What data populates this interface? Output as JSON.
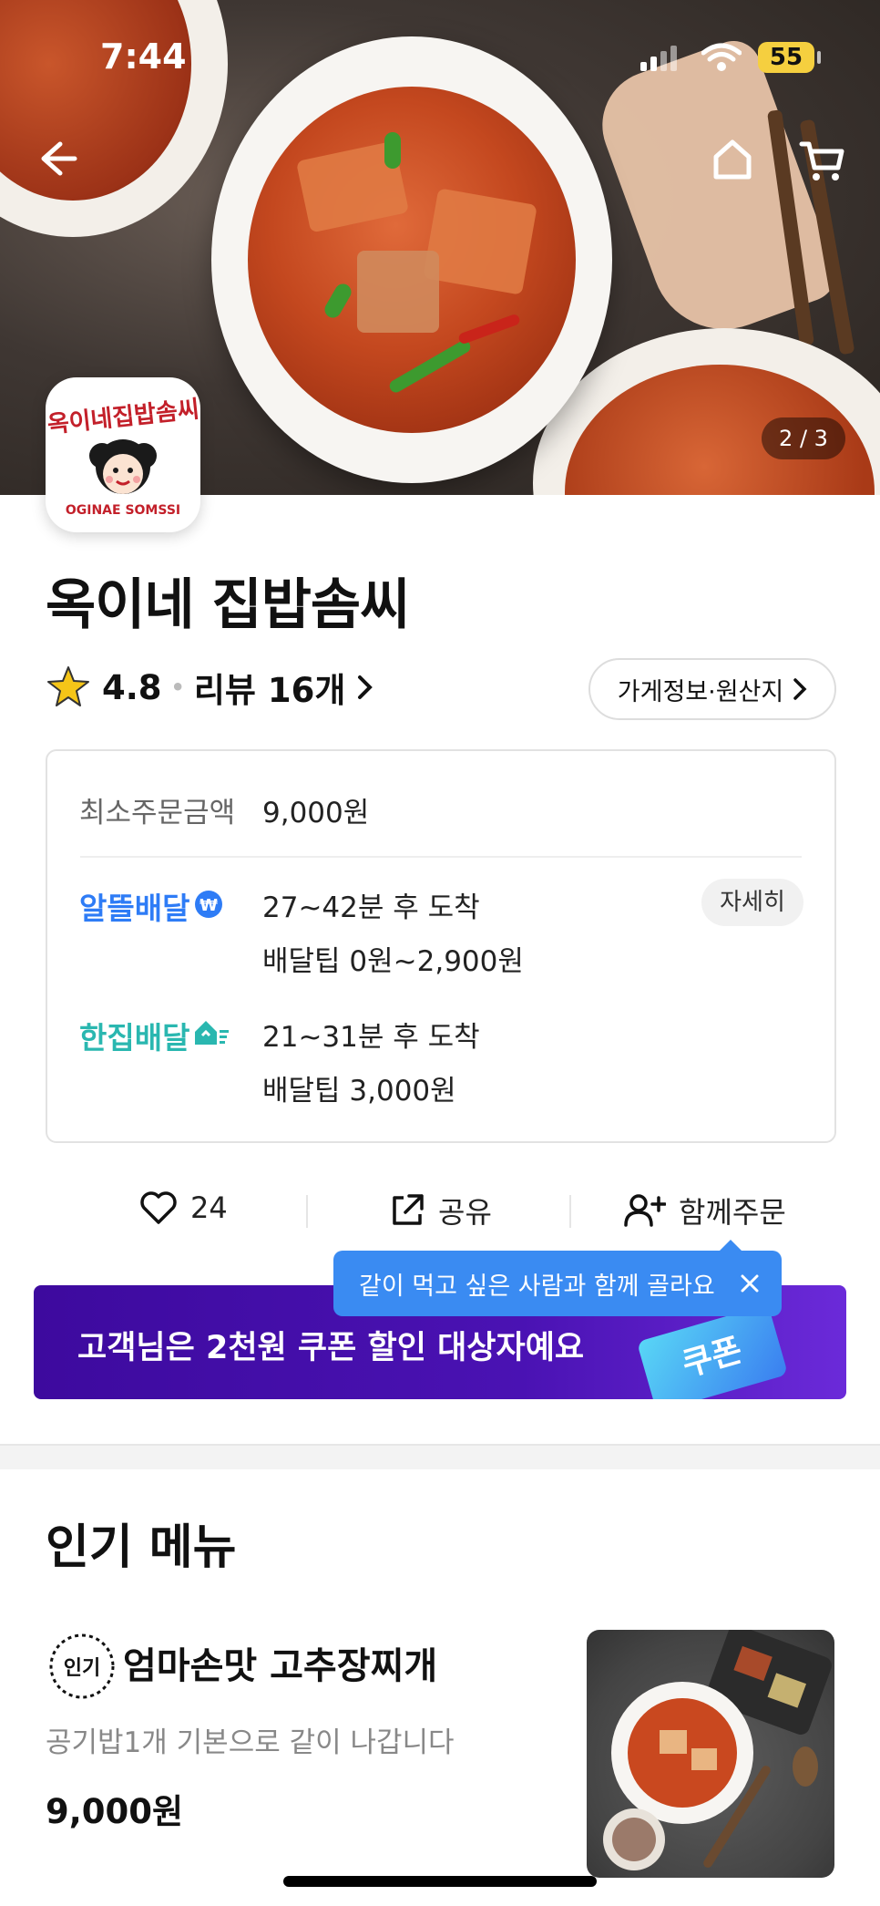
{
  "status_bar": {
    "time": "7:44",
    "battery": "55"
  },
  "hero": {
    "counter": "2 / 3"
  },
  "store": {
    "name": "옥이네 집밥솜씨",
    "logo_text": "옥이네집밥솜씨",
    "logo_subtext": "OGINAE SOMSSI",
    "rating": "4.8",
    "reviews": "리뷰 16개",
    "info_button": "가게정보·원산지"
  },
  "info": {
    "min_order_label": "최소주문금액",
    "min_order_value": "9,000원",
    "delivery_options": [
      {
        "name": "알뜰배달",
        "time": "27~42분 후 도착",
        "tip": "배달팁 0원~2,900원",
        "color": "#2e7cf6"
      },
      {
        "name": "한집배달",
        "time": "21~31분 후 도착",
        "tip": "배달팁 3,000원",
        "color": "#2ab7b0"
      }
    ],
    "detail_button": "자세히"
  },
  "actions": {
    "like_count": "24",
    "share": "공유",
    "group_order": "함께주문"
  },
  "tooltip": {
    "text": "같이 먹고 싶은 사람과 함께 골라요"
  },
  "banner": {
    "text": "고객님은 2천원 쿠폰 할인 대상자예요",
    "coupon_label": "쿠폰"
  },
  "popular": {
    "title": "인기 메뉴",
    "badge": "인기",
    "items": [
      {
        "name": "엄마손맛 고추장찌개",
        "desc": "공기밥1개 기본으로 같이 나갑니다",
        "price": "9,000원"
      }
    ]
  },
  "colors": {
    "accent_purple": "#4a12b3",
    "tooltip_blue": "#3a8bf2",
    "star": "#f5c518"
  }
}
